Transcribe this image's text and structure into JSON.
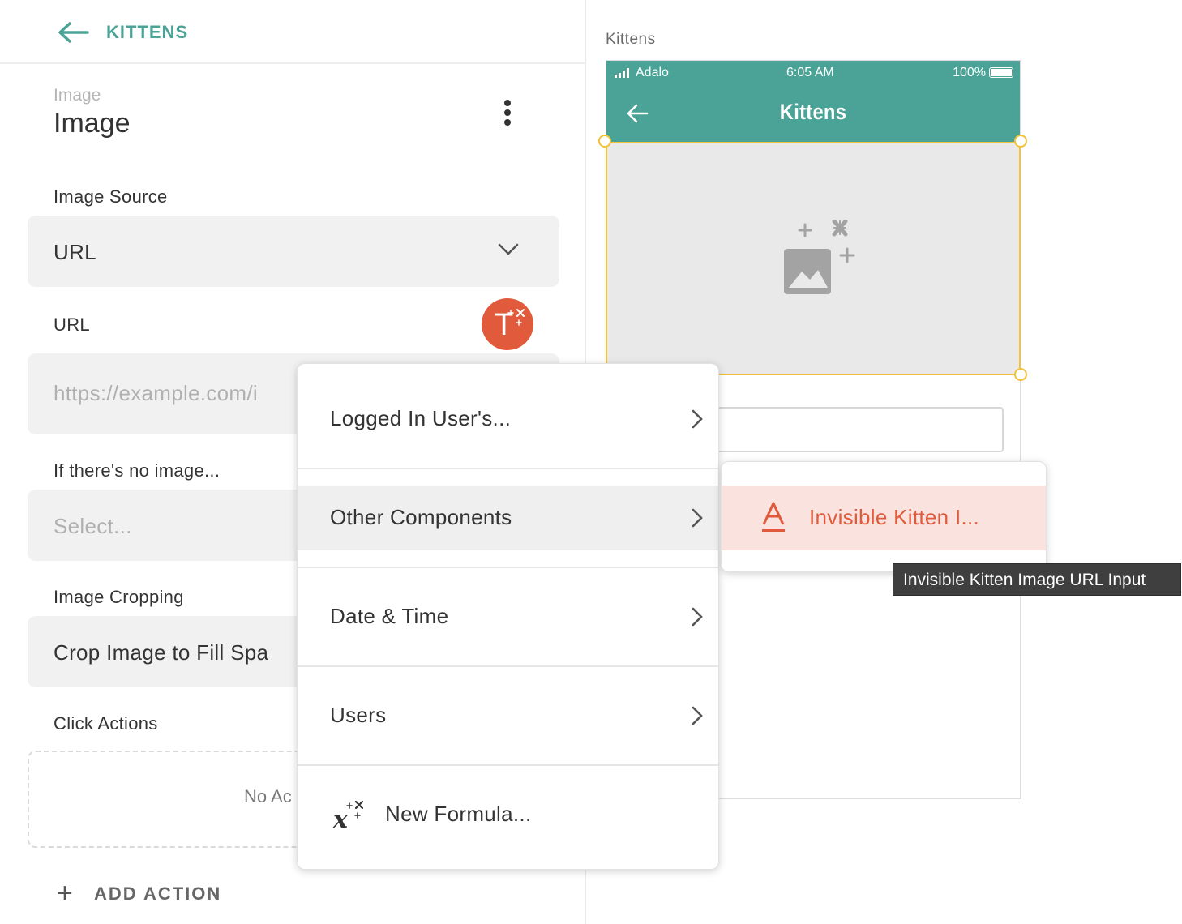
{
  "nav": {
    "back_label": "KITTENS"
  },
  "component": {
    "type_label": "Image",
    "name": "Image"
  },
  "image_source": {
    "label": "Image Source",
    "value": "URL"
  },
  "url": {
    "label": "URL",
    "placeholder": "https://example.com/i"
  },
  "no_image": {
    "label": "If there's no image...",
    "placeholder": "Select..."
  },
  "cropping": {
    "label": "Image Cropping",
    "value": "Crop Image to Fill Spa"
  },
  "click_actions": {
    "label": "Click Actions",
    "empty_text": "No Ac",
    "add_label": "ADD ACTION"
  },
  "canvas": {
    "screen_label": "Kittens",
    "status": {
      "carrier": "Adalo",
      "time": "6:05 AM",
      "battery": "100%"
    },
    "header_title": "Kittens"
  },
  "menu": {
    "items": [
      {
        "label": "Logged In User's..."
      },
      {
        "label": "Other Components"
      },
      {
        "label": "Date & Time"
      },
      {
        "label": "Users"
      },
      {
        "label": "New Formula..."
      }
    ]
  },
  "submenu": {
    "item_label": "Invisible Kitten I..."
  },
  "tooltip": {
    "text": "Invisible Kitten Image URL Input"
  },
  "colors": {
    "accent": "#4aa396",
    "magic": "#e15a3b",
    "selection": "#f2c23a",
    "highlight": "#fae3df"
  },
  "icons": [
    "back-arrow-icon",
    "more-vertical-icon",
    "chevron-down-icon",
    "magic-text-icon",
    "signal-icon",
    "battery-icon",
    "image-placeholder-icon",
    "chevron-right-icon",
    "formula-icon",
    "text-input-icon",
    "plus-icon"
  ]
}
